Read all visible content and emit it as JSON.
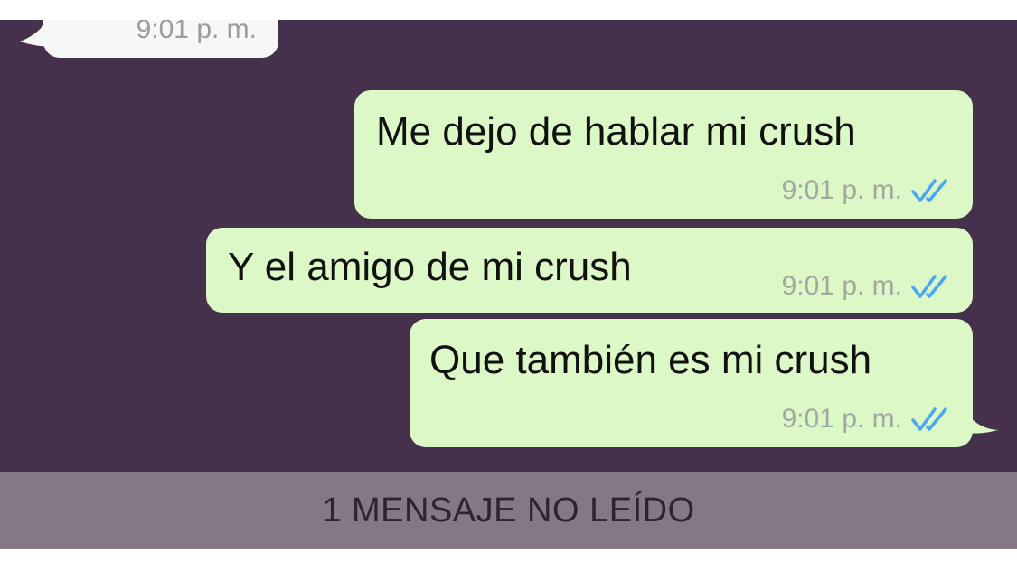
{
  "chat": {
    "incoming_partial": {
      "time": "9:01 p. m."
    },
    "messages": [
      {
        "text": "Me dejo de hablar mi crush",
        "time": "9:01 p. m.",
        "status": "double-check-read"
      },
      {
        "text": "Y el amigo de mi crush",
        "time": "9:01 p. m.",
        "status": "double-check-read"
      },
      {
        "text": "Que también es mi crush",
        "time": "9:01 p. m.",
        "status": "double-check-read"
      }
    ]
  },
  "unread_banner": {
    "label": "1 MENSAJE NO LEÍDO"
  },
  "colors": {
    "chat_background": "#46314c",
    "outgoing_bubble": "#dcf8c6",
    "incoming_bubble": "#f7f7f8",
    "read_check": "#4aa6f0",
    "unread_bar": "#857886"
  }
}
